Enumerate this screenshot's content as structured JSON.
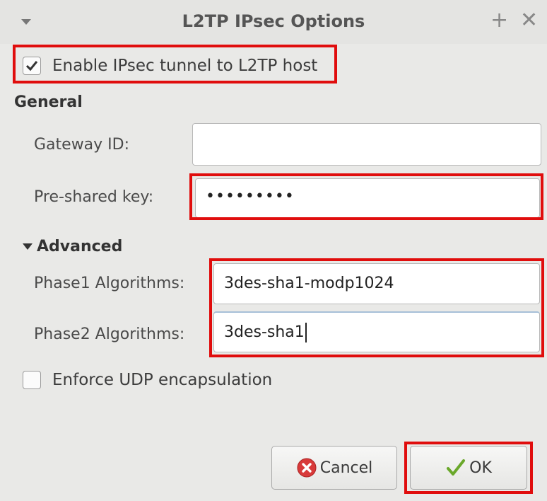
{
  "window": {
    "title": "L2TP IPsec Options",
    "plus_glyph": "+",
    "close_glyph": "✕"
  },
  "enable_ipsec": {
    "label": "Enable IPsec tunnel to L2TP host",
    "checked": true
  },
  "general": {
    "heading": "General",
    "gateway_id": {
      "label": "Gateway ID:",
      "value": ""
    },
    "psk": {
      "label": "Pre-shared key:",
      "masked_value": "•••••••••"
    }
  },
  "advanced": {
    "heading": "Advanced",
    "phase1": {
      "label": "Phase1 Algorithms:",
      "value": "3des-sha1-modp1024"
    },
    "phase2": {
      "label": "Phase2 Algorithms:",
      "value": "3des-sha1"
    }
  },
  "enforce_udp": {
    "label": "Enforce UDP encapsulation",
    "checked": false
  },
  "buttons": {
    "cancel": "Cancel",
    "ok": "OK"
  },
  "colors": {
    "highlight": "#e00d0d",
    "cancel_icon": "#d83a3a",
    "ok_icon": "#6aa82a"
  },
  "icons": {
    "check": "check-icon",
    "cancel": "cancel-circle-icon",
    "ok": "checkmark-icon",
    "expander": "triangle-down-icon"
  }
}
